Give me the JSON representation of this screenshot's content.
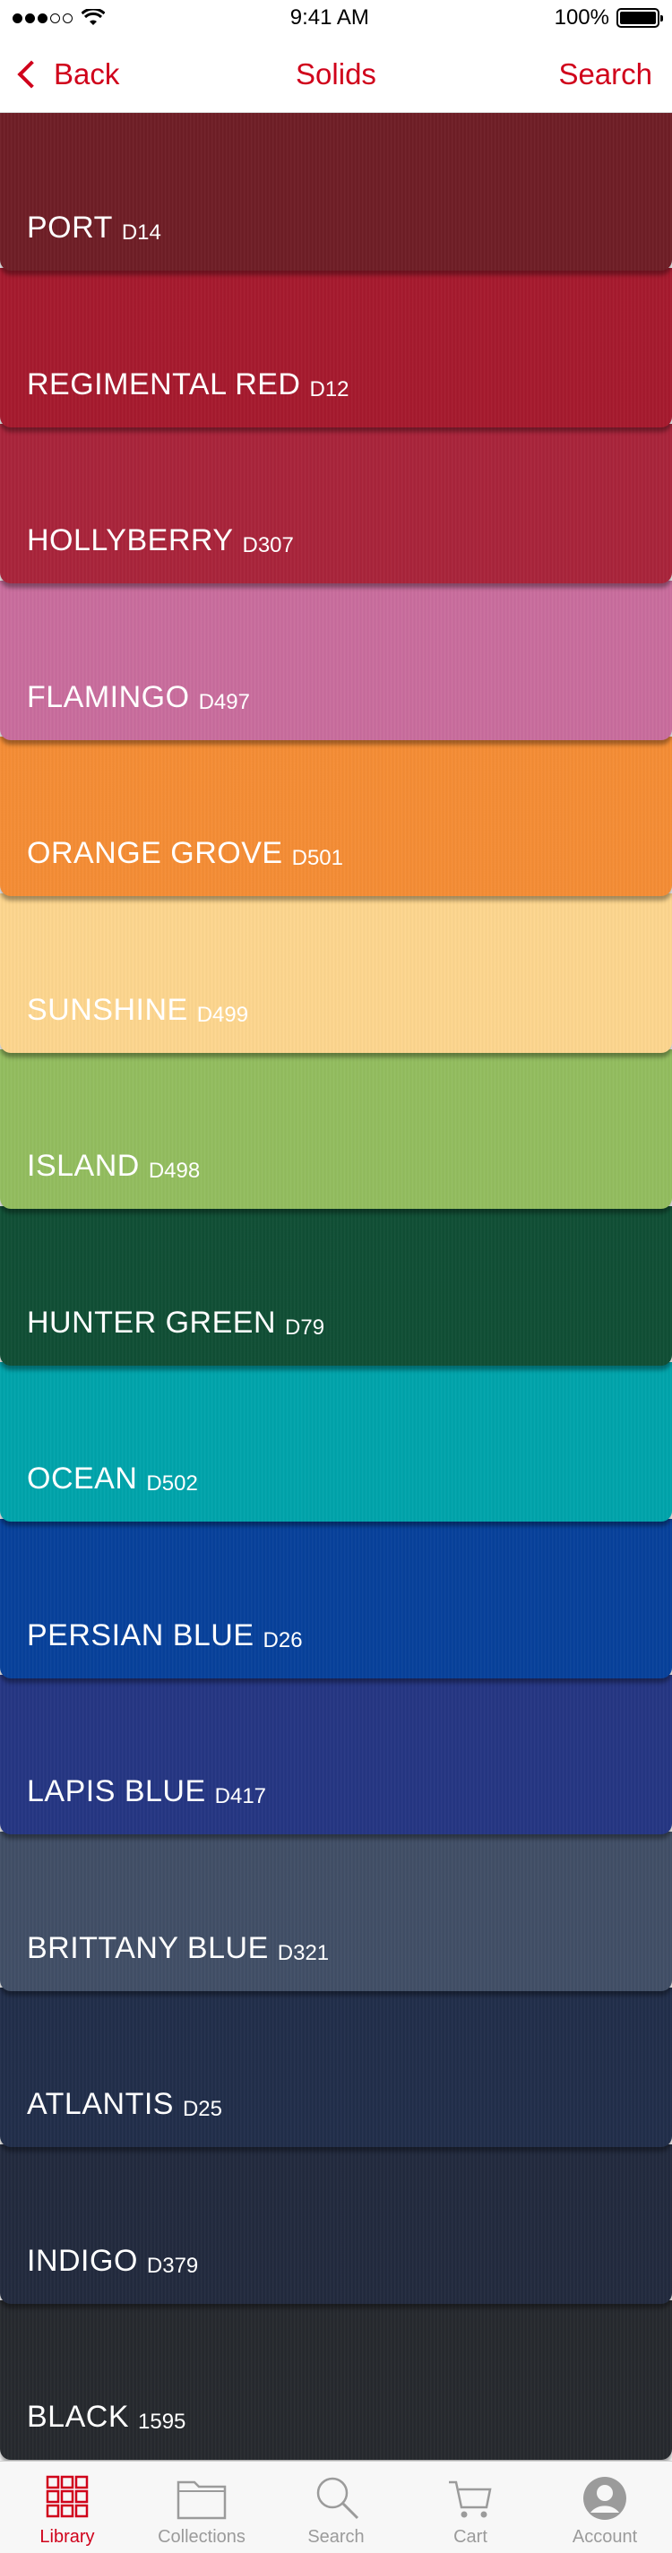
{
  "status_bar": {
    "time": "9:41 AM",
    "battery": "100%",
    "battery_level": 1.0
  },
  "nav": {
    "back_label": "Back",
    "title": "Solids",
    "search_label": "Search"
  },
  "swatches": [
    {
      "name": "PORT",
      "code": "D14",
      "color": "#6f1e26"
    },
    {
      "name": "REGIMENTAL RED",
      "code": "D12",
      "color": "#a61a2e"
    },
    {
      "name": "HOLLYBERRY",
      "code": "D307",
      "color": "#a9243b"
    },
    {
      "name": "FLAMINGO",
      "code": "D497",
      "color": "#c96d9d"
    },
    {
      "name": "ORANGE GROVE",
      "code": "D501",
      "color": "#f58d35"
    },
    {
      "name": "SUNSHINE",
      "code": "D499",
      "color": "#fdd68e"
    },
    {
      "name": "ISLAND",
      "code": "D498",
      "color": "#93bd5f"
    },
    {
      "name": "HUNTER GREEN",
      "code": "D79",
      "color": "#104f35"
    },
    {
      "name": "OCEAN",
      "code": "D502",
      "color": "#00a4ab"
    },
    {
      "name": "PERSIAN BLUE",
      "code": "D26",
      "color": "#07419b"
    },
    {
      "name": "LAPIS BLUE",
      "code": "D417",
      "color": "#253683"
    },
    {
      "name": "BRITTANY BLUE",
      "code": "D321",
      "color": "#414f66"
    },
    {
      "name": "ATLANTIS",
      "code": "D25",
      "color": "#212e4a"
    },
    {
      "name": "INDIGO",
      "code": "D379",
      "color": "#222a3e"
    },
    {
      "name": "BLACK",
      "code": "1595",
      "color": "#26292e"
    }
  ],
  "tabs": [
    {
      "label": "Library",
      "icon": "library-grid-icon",
      "active": true
    },
    {
      "label": "Collections",
      "icon": "folder-icon",
      "active": false
    },
    {
      "label": "Search",
      "icon": "search-icon",
      "active": false
    },
    {
      "label": "Cart",
      "icon": "cart-icon",
      "active": false
    },
    {
      "label": "Account",
      "icon": "account-icon",
      "active": false
    }
  ],
  "colors": {
    "accent": "#d0021b",
    "tab_inactive": "#9b9b9b"
  }
}
